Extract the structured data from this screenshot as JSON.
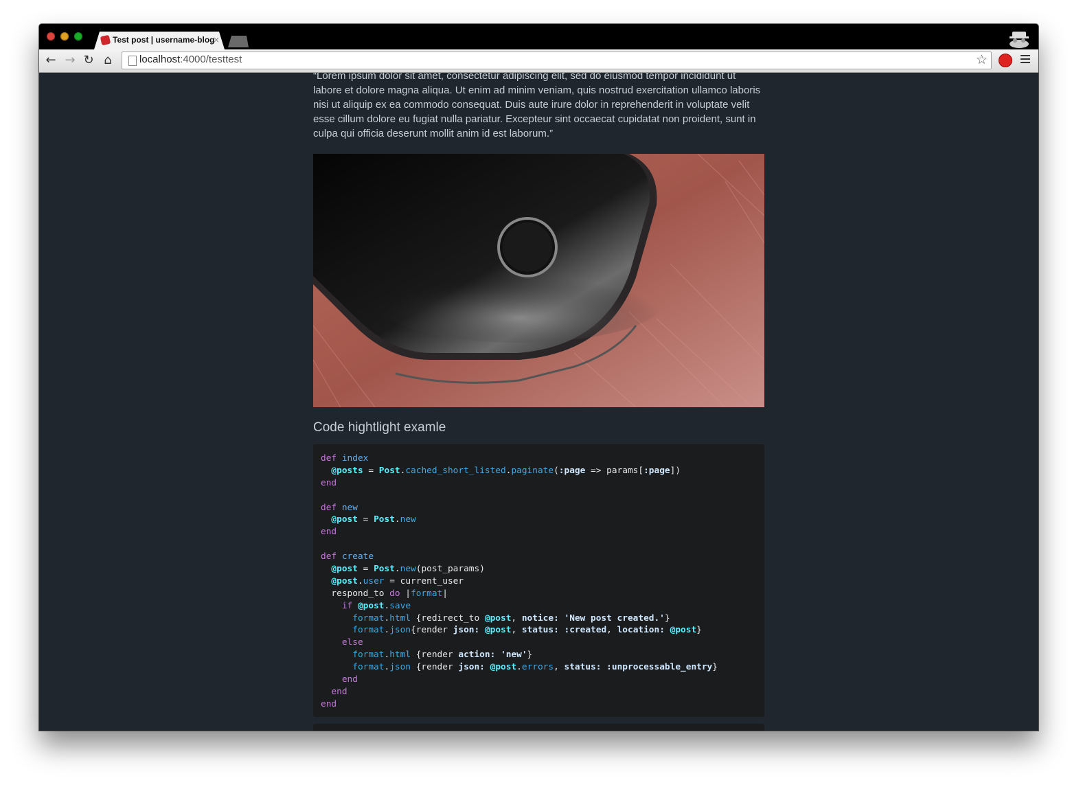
{
  "browser": {
    "tab_title": "Test post | username-blog",
    "tab_close": "×",
    "url_host": "localhost",
    "url_path": ":4000/testtest",
    "icons": [
      "back-arrow-icon",
      "forward-arrow-icon",
      "reload-icon",
      "home-icon",
      "page-icon",
      "star-icon",
      "extension-icon",
      "menu-icon",
      "incognito-icon"
    ]
  },
  "article": {
    "quote": "“Lorem ipsum dolor sit amet, consectetur adipiscing elit, sed do eiusmod tempor incididunt ut labore et dolore magna aliqua. Ut enim ad minim veniam, quis nostrud exercitation ullamco laboris nisi ut aliquip ex ea commodo consequat. Duis aute irure dolor in reprehenderit in voluptate velit esse cillum dolore eu fugiat nulla pariatur. Excepteur sint occaecat cupidatat non proident, sunt in culpa qui officia deserunt mollit anim id est laborum.”",
    "image_subject": "smartphone-on-wooden-table",
    "section_heading": "Code hightlight examle"
  },
  "code": {
    "lines": [
      {
        "t": [
          [
            "kw",
            "def "
          ],
          [
            "fn",
            "index"
          ]
        ]
      },
      {
        "t": [
          [
            "pl",
            "  "
          ],
          [
            "iv",
            "@posts"
          ],
          [
            "pl",
            " = "
          ],
          [
            "cls",
            "Post"
          ],
          [
            "pl",
            "."
          ],
          [
            "mt",
            "cached_short_listed"
          ],
          [
            "pl",
            "."
          ],
          [
            "mt",
            "paginate"
          ],
          [
            "pl",
            "("
          ],
          [
            "sym",
            ":page"
          ],
          [
            "pl",
            " => params["
          ],
          [
            "sym",
            ":page"
          ],
          [
            "pl",
            "])"
          ]
        ]
      },
      {
        "t": [
          [
            "kw",
            "end"
          ]
        ]
      },
      {
        "t": []
      },
      {
        "t": [
          [
            "kw",
            "def "
          ],
          [
            "fn",
            "new"
          ]
        ]
      },
      {
        "t": [
          [
            "pl",
            "  "
          ],
          [
            "iv",
            "@post"
          ],
          [
            "pl",
            " = "
          ],
          [
            "cls",
            "Post"
          ],
          [
            "pl",
            "."
          ],
          [
            "mt",
            "new"
          ]
        ]
      },
      {
        "t": [
          [
            "kw",
            "end"
          ]
        ]
      },
      {
        "t": []
      },
      {
        "t": [
          [
            "kw",
            "def "
          ],
          [
            "fn",
            "create"
          ]
        ]
      },
      {
        "t": [
          [
            "pl",
            "  "
          ],
          [
            "iv",
            "@post"
          ],
          [
            "pl",
            " = "
          ],
          [
            "cls",
            "Post"
          ],
          [
            "pl",
            "."
          ],
          [
            "mt",
            "new"
          ],
          [
            "pl",
            "(post_params)"
          ]
        ]
      },
      {
        "t": [
          [
            "pl",
            "  "
          ],
          [
            "iv",
            "@post"
          ],
          [
            "pl",
            "."
          ],
          [
            "mt",
            "user"
          ],
          [
            "pl",
            " = current_user"
          ]
        ]
      },
      {
        "t": [
          [
            "pl",
            "  respond_to "
          ],
          [
            "kw",
            "do"
          ],
          [
            "pl",
            " |"
          ],
          [
            "var",
            "format"
          ],
          [
            "pl",
            "|"
          ]
        ]
      },
      {
        "t": [
          [
            "pl",
            "    "
          ],
          [
            "kw",
            "if "
          ],
          [
            "iv",
            "@post"
          ],
          [
            "pl",
            "."
          ],
          [
            "mt",
            "save"
          ]
        ]
      },
      {
        "t": [
          [
            "pl",
            "      "
          ],
          [
            "var",
            "format"
          ],
          [
            "pl",
            "."
          ],
          [
            "mt",
            "html"
          ],
          [
            "pl",
            " {redirect_to "
          ],
          [
            "iv",
            "@post"
          ],
          [
            "pl",
            ", "
          ],
          [
            "sym",
            "notice:"
          ],
          [
            "pl",
            " "
          ],
          [
            "str",
            "'New post created.'"
          ],
          [
            "pl",
            "}"
          ]
        ]
      },
      {
        "t": [
          [
            "pl",
            "      "
          ],
          [
            "var",
            "format"
          ],
          [
            "pl",
            "."
          ],
          [
            "mt",
            "json"
          ],
          [
            "pl",
            "{render "
          ],
          [
            "sym",
            "json:"
          ],
          [
            "pl",
            " "
          ],
          [
            "iv",
            "@post"
          ],
          [
            "pl",
            ", "
          ],
          [
            "sym",
            "status:"
          ],
          [
            "pl",
            " "
          ],
          [
            "sym",
            ":created"
          ],
          [
            "pl",
            ", "
          ],
          [
            "sym",
            "location:"
          ],
          [
            "pl",
            " "
          ],
          [
            "iv",
            "@post"
          ],
          [
            "pl",
            "}"
          ]
        ]
      },
      {
        "t": [
          [
            "pl",
            "    "
          ],
          [
            "kw",
            "else"
          ]
        ]
      },
      {
        "t": [
          [
            "pl",
            "      "
          ],
          [
            "var",
            "format"
          ],
          [
            "pl",
            "."
          ],
          [
            "mt",
            "html"
          ],
          [
            "pl",
            " {render "
          ],
          [
            "sym",
            "action:"
          ],
          [
            "pl",
            " "
          ],
          [
            "str",
            "'new'"
          ],
          [
            "pl",
            "}"
          ]
        ]
      },
      {
        "t": [
          [
            "pl",
            "      "
          ],
          [
            "var",
            "format"
          ],
          [
            "pl",
            "."
          ],
          [
            "mt",
            "json"
          ],
          [
            "pl",
            " {render "
          ],
          [
            "sym",
            "json:"
          ],
          [
            "pl",
            " "
          ],
          [
            "iv",
            "@post"
          ],
          [
            "pl",
            "."
          ],
          [
            "mt",
            "errors"
          ],
          [
            "pl",
            ", "
          ],
          [
            "sym",
            "status:"
          ],
          [
            "pl",
            " "
          ],
          [
            "sym",
            ":unprocessable_entry"
          ],
          [
            "pl",
            "}"
          ]
        ]
      },
      {
        "t": [
          [
            "pl",
            "    "
          ],
          [
            "kw",
            "end"
          ]
        ]
      },
      {
        "t": [
          [
            "pl",
            "  "
          ],
          [
            "kw",
            "end"
          ]
        ]
      },
      {
        "t": [
          [
            "kw",
            "end"
          ]
        ]
      }
    ]
  },
  "colors": {
    "page_bg": "#1f262e",
    "code_bg": "#1b1c1e",
    "keyword": "#c678dd",
    "function": "#61afef",
    "ivar": "#56f0ff"
  }
}
